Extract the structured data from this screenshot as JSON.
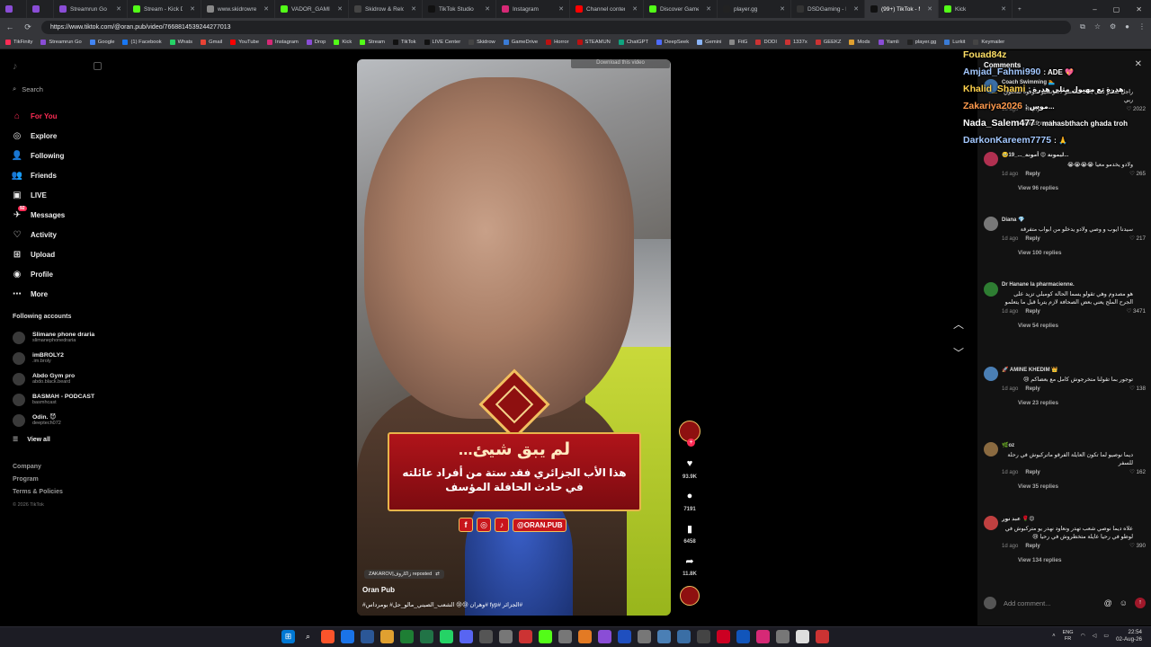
{
  "browser": {
    "tabs": [
      {
        "label": "",
        "color": "#8a4dd6"
      },
      {
        "label": "",
        "color": "#8a4dd6"
      },
      {
        "label": "Streamrun Go",
        "color": "#8a4dd6"
      },
      {
        "label": "Stream - Kick Dashb",
        "color": "#53fc18"
      },
      {
        "label": "www.skidrowreloade",
        "color": "#888888"
      },
      {
        "label": "VADOR_GAMING Str",
        "color": "#53fc18"
      },
      {
        "label": "Skidrow & Reloaded",
        "color": "#444444"
      },
      {
        "label": "TikTok Studio",
        "color": "#111111"
      },
      {
        "label": "Instagram",
        "color": "#d62976"
      },
      {
        "label": "Channel content - Yo",
        "color": "#ff0000"
      },
      {
        "label": "Discover Games - Ki",
        "color": "#53fc18"
      },
      {
        "label": "player.gg",
        "color": "#222222"
      },
      {
        "label": "DSDGaming - PC Gu",
        "color": "#333333"
      },
      {
        "label": "(99+) TikTok - M",
        "color": "#111111"
      },
      {
        "label": "Kick",
        "color": "#53fc18"
      }
    ],
    "active_tab_index": 13,
    "url": "https://www.tiktok.com/@oran.pub/video/7668814539244277013",
    "bookmarks": [
      {
        "label": "TikFinity",
        "color": "#fe2c55"
      },
      {
        "label": "Streamrun Go",
        "color": "#8a4dd6"
      },
      {
        "label": "Google",
        "color": "#4285f4"
      },
      {
        "label": "(1) Facebook",
        "color": "#1877f2"
      },
      {
        "label": "Whats",
        "color": "#25d366"
      },
      {
        "label": "Gmail",
        "color": "#ea4335"
      },
      {
        "label": "YouTube",
        "color": "#ff0000"
      },
      {
        "label": "Instagram",
        "color": "#d62976"
      },
      {
        "label": "Drop",
        "color": "#8a4dd6"
      },
      {
        "label": "Kick",
        "color": "#53fc18"
      },
      {
        "label": "Stream",
        "color": "#53fc18"
      },
      {
        "label": "TikTok",
        "color": "#111111"
      },
      {
        "label": "LIVE Center",
        "color": "#111111"
      },
      {
        "label": "Skidrow",
        "color": "#444444"
      },
      {
        "label": "GameDrive",
        "color": "#3a7bd5"
      },
      {
        "label": "Horror",
        "color": "#b11"
      },
      {
        "label": "STEAMUN",
        "color": "#b11"
      },
      {
        "label": "ChatGPT",
        "color": "#10a37f"
      },
      {
        "label": "DeepSeek",
        "color": "#4d6bfe"
      },
      {
        "label": "Gemini",
        "color": "#8ab4f8"
      },
      {
        "label": "FitG",
        "color": "#888"
      },
      {
        "label": "DODI",
        "color": "#c33"
      },
      {
        "label": "1337x",
        "color": "#c33"
      },
      {
        "label": "GEEKZ",
        "color": "#c33"
      },
      {
        "label": "Mods",
        "color": "#e0a030"
      },
      {
        "label": "Yamli",
        "color": "#8a4dd6"
      },
      {
        "label": "player.gg",
        "color": "#222"
      },
      {
        "label": "Lurkit",
        "color": "#3a7bd5"
      },
      {
        "label": "Keymailer",
        "color": "#444"
      }
    ]
  },
  "sidebar": {
    "search_placeholder": "Search",
    "nav": [
      {
        "label": "For You",
        "icon": "home-icon",
        "active": true
      },
      {
        "label": "Explore",
        "icon": "compass-icon"
      },
      {
        "label": "Following",
        "icon": "following-icon"
      },
      {
        "label": "Friends",
        "icon": "friends-icon"
      },
      {
        "label": "LIVE",
        "icon": "live-icon"
      },
      {
        "label": "Messages",
        "icon": "messages-icon",
        "badge": "92"
      },
      {
        "label": "Activity",
        "icon": "activity-icon"
      },
      {
        "label": "Upload",
        "icon": "upload-icon"
      },
      {
        "label": "Profile",
        "icon": "profile-icon"
      },
      {
        "label": "More",
        "icon": "more-icon"
      }
    ],
    "following_title": "Following accounts",
    "following": [
      {
        "name": "Slimane phone draria",
        "handle": "slimanephonedraria"
      },
      {
        "name": "imBROLY2",
        "handle": ".im.broly"
      },
      {
        "name": "Abdo Gym pro",
        "handle": "abdo.black.beard"
      },
      {
        "name": "BASMAH - PODCAST",
        "handle": "basmhcast"
      },
      {
        "name": "Odin. 😈",
        "handle": "deeptech072"
      }
    ],
    "view_all": "View all",
    "footer_links": [
      "Company",
      "Program",
      "Terms & Policies"
    ],
    "copyright": "© 2026 TikTok"
  },
  "video": {
    "download_banner": "Download this video",
    "caption_title": "لم يبق شيئ...",
    "caption_body": "هذا الأب الجزائري فقد ستة من أفراد عائلته في حادث الحافلة المؤسف",
    "social_handle": "@ORAN.PUB",
    "repost_text": "ZAKAROV|زاكاروف reposted",
    "author": "Oran Pub",
    "description": "#الجزائر #fyp #وهران 😢😢 الشعب_الصيني_مالو_حل# بومرداس#"
  },
  "actions": {
    "likes": "93.9K",
    "comments": "7191",
    "saves": "6458",
    "shares": "11.8K"
  },
  "comments": {
    "title": "Comments",
    "input_placeholder": "Add comment...",
    "items": [
      {
        "user": "Coach Swimming 🏊",
        "text": "راجل لساتو ثقال بالاك طلعتلو لاطونسيو شوفوه لمخلوق ربي",
        "time": "1d ago",
        "reply": "Reply",
        "likes": "2022",
        "replies": "View 19 replies"
      },
      {
        "user": "🥹19_..._ليمونة 😍 أمونة...",
        "text": "ولادو يخدمو معيا 😭😭😭😭",
        "time": "1d ago",
        "reply": "Reply",
        "likes": "265",
        "replies": "View 96 replies"
      },
      {
        "user": "Diana 💎",
        "text": "سيدنا ايوب و وصي ولادو يدخلو من ابواب متفرقة",
        "time": "1d ago",
        "reply": "Reply",
        "likes": "217",
        "replies": "View 100 replies"
      },
      {
        "user": "Dr Hanane la pharmacienne.",
        "text": "هو مصدوم وهي تقولو يسما الحالة كومبلي تزيد على الجرح الملح يعني بعض الصحافة لازم يتربا قبل ما يتعلمو",
        "time": "1d ago",
        "reply": "Reply",
        "likes": "3471",
        "replies": "View 54 replies"
      },
      {
        "user": "🚀 AMINE KHEDIM 👑",
        "text": "توجور بما تقولنا متخرجوش كامل مع بعضاكم 😢",
        "time": "1d ago",
        "reply": "Reply",
        "likes": "138",
        "replies": "View 23 replies"
      },
      {
        "user": "🌿oz",
        "text": "ديما نوصيو لما تكون العايلة الفرقو ماتركبوش في رحلة للسفر",
        "time": "1d ago",
        "reply": "Reply",
        "likes": "162",
        "replies": "View 35 replies"
      },
      {
        "user": "عبد نور 🌹😍",
        "text": "علاه ديما نوصي شعب تهدر ونعاود نهدر يو متركبوش في لوطو في رحيا عايلة متخطروش في رحيا 😢",
        "time": "1d ago",
        "reply": "Reply",
        "likes": "390",
        "replies": "View 134 replies"
      }
    ]
  },
  "chat_overlay": [
    {
      "user": "Fouad84z",
      "msg": "",
      "color": "#ffe066"
    },
    {
      "user": "Amjad_Fahmi990",
      "msg": ": ADE 💖",
      "color": "#a3c8ff"
    },
    {
      "user": "Khalid_Shami",
      "msg": ": هدرة تع مهبول مثلي هدرة",
      "color": "#ffd24d"
    },
    {
      "user": "Zakariya2026",
      "msg": ": موس...",
      "color": "#ff9a4d"
    },
    {
      "user": "Nada_Salem477",
      "msg": ": mahasbthach ghada troh",
      "color": "#ffffff"
    },
    {
      "user": "DarkonKareem7775",
      "msg": ": 🙏",
      "color": "#a3c8ff"
    }
  ],
  "taskbar": {
    "lang_top": "ENG",
    "lang_bottom": "FR",
    "time": "22:54",
    "date": "02-Aug-26"
  }
}
